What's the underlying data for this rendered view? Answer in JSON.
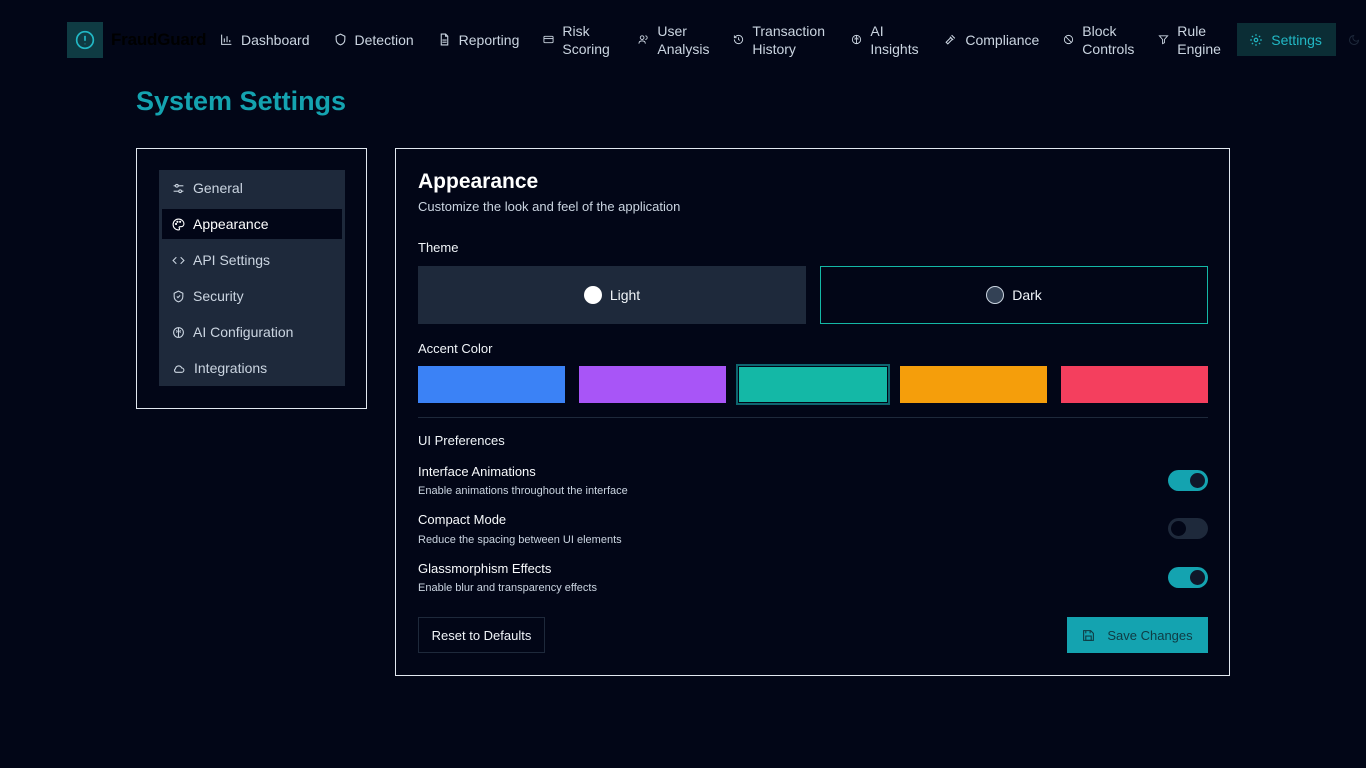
{
  "app": {
    "name": "FraudGuard",
    "logo_icon": "alert-circle-icon",
    "accent": "#14a3b0"
  },
  "nav": {
    "items": [
      {
        "label": "Dashboard",
        "icon": "bar-chart-icon"
      },
      {
        "label": "Detection",
        "icon": "shield-icon"
      },
      {
        "label": "Reporting",
        "icon": "file-text-icon"
      },
      {
        "label": "Risk Scoring",
        "icon": "credit-card-icon"
      },
      {
        "label": "User Analysis",
        "icon": "users-icon"
      },
      {
        "label": "Transaction History",
        "icon": "history-icon"
      },
      {
        "label": "AI Insights",
        "icon": "brain-icon"
      },
      {
        "label": "Compliance",
        "icon": "gavel-icon"
      },
      {
        "label": "Block Controls",
        "icon": "ban-icon"
      },
      {
        "label": "Rule Engine",
        "icon": "filter-icon"
      },
      {
        "label": "Settings",
        "icon": "gear-icon",
        "active": true
      }
    ],
    "theme_toggle_icon": "moon-icon"
  },
  "page": {
    "title": "System Settings"
  },
  "sidebar": {
    "items": [
      {
        "label": "General",
        "icon": "sliders-icon"
      },
      {
        "label": "Appearance",
        "icon": "palette-icon",
        "active": true
      },
      {
        "label": "API Settings",
        "icon": "code-icon"
      },
      {
        "label": "Security",
        "icon": "shield-check-icon"
      },
      {
        "label": "AI Configuration",
        "icon": "brain-icon"
      },
      {
        "label": "Integrations",
        "icon": "cloud-icon"
      }
    ]
  },
  "appearance": {
    "title": "Appearance",
    "subtitle": "Customize the look and feel of the application",
    "theme_label": "Theme",
    "themes": [
      {
        "label": "Light",
        "selected": false
      },
      {
        "label": "Dark",
        "selected": true
      }
    ],
    "accent_label": "Accent Color",
    "accent_colors": [
      {
        "color": "#3b82f6",
        "selected": false
      },
      {
        "color": "#a855f7",
        "selected": false
      },
      {
        "color": "#14b8a6",
        "selected": true
      },
      {
        "color": "#f59e0b",
        "selected": false
      },
      {
        "color": "#f43f5e",
        "selected": false
      }
    ],
    "ui_prefs_label": "UI Preferences",
    "prefs": [
      {
        "title": "Interface Animations",
        "desc": "Enable animations throughout the interface",
        "enabled": true
      },
      {
        "title": "Compact Mode",
        "desc": "Reduce the spacing between UI elements",
        "enabled": false
      },
      {
        "title": "Glassmorphism Effects",
        "desc": "Enable blur and transparency effects",
        "enabled": true
      }
    ],
    "reset_label": "Reset to Defaults",
    "save_label": "Save Changes",
    "save_icon": "save-icon"
  }
}
